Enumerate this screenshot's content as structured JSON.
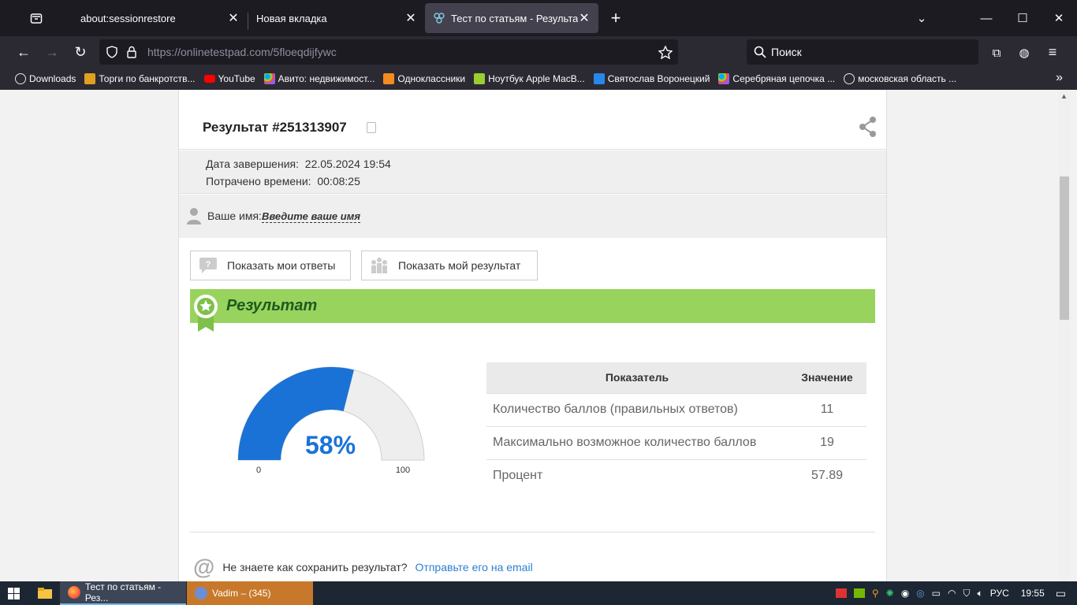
{
  "browser": {
    "tabs": [
      {
        "label": "about:sessionrestore"
      },
      {
        "label": "Новая вкладка"
      },
      {
        "label": "Тест по статьям - Результат он"
      }
    ],
    "url_host": "https://onlinetestpad.com/",
    "url_path": "5floeqdijfywc",
    "search_placeholder": "Поиск",
    "bookmarks": [
      {
        "label": "Downloads",
        "color": "#e5e5e5"
      },
      {
        "label": "Торги по банкротств...",
        "color": "#e0a020"
      },
      {
        "label": "YouTube",
        "color": "#ff0000"
      },
      {
        "label": "Авито: недвижимост...",
        "color": "#00aaff"
      },
      {
        "label": "Одноклассники",
        "color": "#f28c1e"
      },
      {
        "label": "Ноутбук Apple MacB...",
        "color": "#9acd32"
      },
      {
        "label": "Святослав Воронецкий",
        "color": "#2688eb"
      },
      {
        "label": "Серебряная цепочка ...",
        "color": "#00aaff"
      },
      {
        "label": "московская область ...",
        "color": "#e5e5e5"
      }
    ]
  },
  "result": {
    "title": "Результат #251313907",
    "finish_label": "Дата завершения:",
    "finish_value": "22.05.2024 19:54",
    "spent_label": "Потрачено времени:",
    "spent_value": "00:08:25",
    "name_label": "Ваше имя:",
    "name_value": "Введите ваше имя",
    "btn_answers": "Показать мои ответы",
    "btn_result": "Показать мой результат",
    "banner": "Результат",
    "gauge_percent": 57.89,
    "gauge_label": "58%",
    "gauge_min": "0",
    "gauge_max": "100",
    "table": {
      "col1": "Показатель",
      "col2": "Значение",
      "rows": [
        {
          "name": "Количество баллов (правильных ответов)",
          "value": "11"
        },
        {
          "name": "Максимально возможное количество баллов",
          "value": "19"
        },
        {
          "name": "Процент",
          "value": "57.89"
        }
      ]
    },
    "save_question": "Не знаете как сохранить результат?",
    "save_link": "Отправьте его на email"
  },
  "taskbar": {
    "task1": "Тест по статьям - Рез...",
    "task2": "Vadim – (345)",
    "lang": "РУС",
    "time": "19:55"
  }
}
